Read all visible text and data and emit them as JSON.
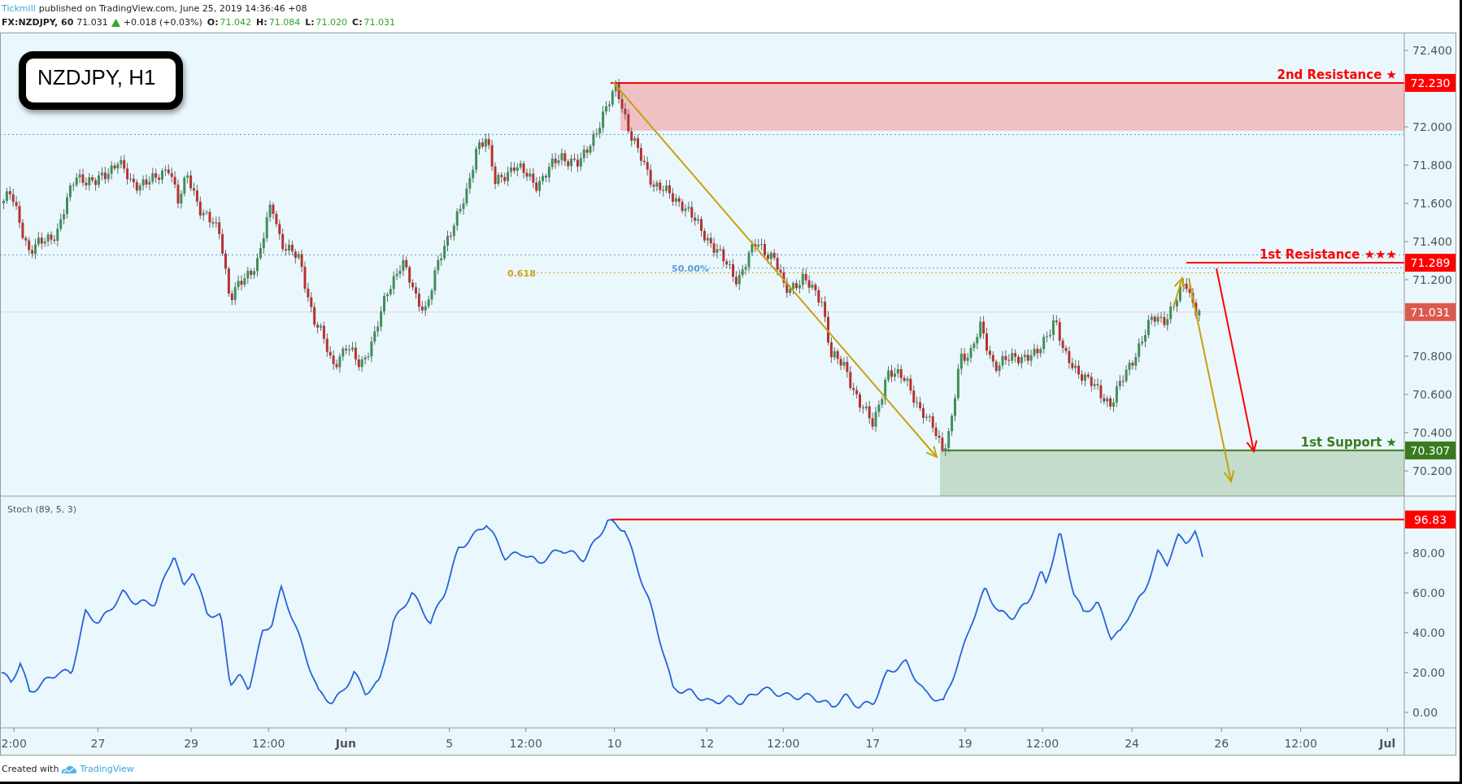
{
  "header": {
    "publisher": "Tickmill",
    "published": "published on TradingView.com, June 25, 2019 14:36:46 +08"
  },
  "quote": {
    "symbol": "FX:NZDJPY, 60",
    "last": "71.031",
    "change": "+0.018 (+0.03%)",
    "ohlc": [
      {
        "label": "O:",
        "value": "71.042"
      },
      {
        "label": "H:",
        "value": "71.084"
      },
      {
        "label": "L:",
        "value": "71.020"
      },
      {
        "label": "C:",
        "value": "71.031"
      }
    ]
  },
  "chart_title": "NZDJPY, H1",
  "price_axis": [
    "72.400",
    "72.000",
    "71.800",
    "71.600",
    "71.400",
    "71.200",
    "70.800",
    "70.600",
    "70.400",
    "70.200"
  ],
  "levels": [
    {
      "label": "2nd Resistance ★",
      "price_tag": "72.230",
      "color": "#ff0000",
      "zone": true
    },
    {
      "label": "1st Resistance ★★★",
      "price_tag": "71.289",
      "color": "#ff0000"
    },
    {
      "label": "1st Support ★",
      "price_tag": "70.307",
      "color": "#3a7a1e",
      "zone": true
    }
  ],
  "last_price_tag": "71.031",
  "fib_labels": [
    {
      "label": "0.618",
      "color": "#d4a017"
    },
    {
      "label": "50.00%",
      "color": "#5b9bd5"
    }
  ],
  "indicator": {
    "label": "Stoch (89, 5, 3)",
    "ticks": [
      "80.00",
      "60.00",
      "40.00",
      "20.00",
      "0.00"
    ],
    "level_tag": "96.83"
  },
  "time_axis": [
    {
      "label": "2:00",
      "kind": "time"
    },
    {
      "label": "27",
      "kind": "day"
    },
    {
      "label": "29",
      "kind": "day"
    },
    {
      "label": "12:00",
      "kind": "time"
    },
    {
      "label": "Jun",
      "kind": "month"
    },
    {
      "label": "5",
      "kind": "day"
    },
    {
      "label": "12:00",
      "kind": "time"
    },
    {
      "label": "10",
      "kind": "day"
    },
    {
      "label": "12",
      "kind": "day"
    },
    {
      "label": "12:00",
      "kind": "time"
    },
    {
      "label": "17",
      "kind": "day"
    },
    {
      "label": "19",
      "kind": "day"
    },
    {
      "label": "12:00",
      "kind": "time"
    },
    {
      "label": "24",
      "kind": "day"
    },
    {
      "label": "26",
      "kind": "day"
    },
    {
      "label": "12:00",
      "kind": "time"
    },
    {
      "label": "Jul",
      "kind": "month"
    }
  ],
  "footer": {
    "text": "Created with",
    "brand": "TradingView"
  }
}
